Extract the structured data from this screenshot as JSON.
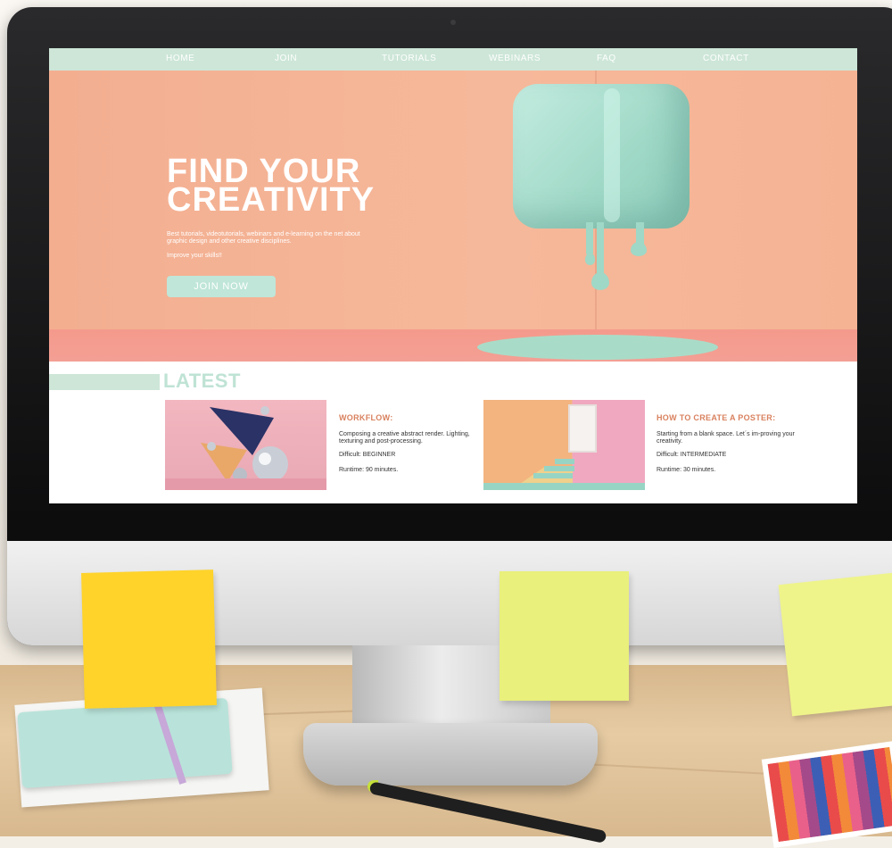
{
  "nav": {
    "items": [
      {
        "label": "HOME"
      },
      {
        "label": "JOIN"
      },
      {
        "label": "TUTORIALS"
      },
      {
        "label": "WEBINARS"
      },
      {
        "label": "FAQ"
      },
      {
        "label": "CONTACT"
      }
    ]
  },
  "hero": {
    "title_line1": "FIND YOUR",
    "title_line2": "CREATIVITY",
    "subtitle": "Best tutorials, videotutorials, webinars and e-learning on the net about graphic design and other creative disciplines.",
    "improve": "Improve your skills!!",
    "cta_label": "JOIN NOW"
  },
  "latest": {
    "heading": "LATEST",
    "cards": [
      {
        "title": "WORKFLOW:",
        "description": "Composing a creative abstract render. Lighting, texturing and post-processing.",
        "difficulty": "Difficult: BEGINNER",
        "runtime": "Runtime: 90 minutes."
      },
      {
        "title": "HOW TO CREATE A POSTER:",
        "description": "Starting from a blank space. Let´s im-proving your creativity.",
        "difficulty": "Difficult: INTERMEDIATE",
        "runtime": "Runtime: 30 minutes."
      }
    ]
  },
  "colors": {
    "nav_bar": "#cde6d8",
    "hero_bg": "#f6b89a",
    "accent_mint": "#9fd8c6",
    "card_title": "#d9815e"
  }
}
